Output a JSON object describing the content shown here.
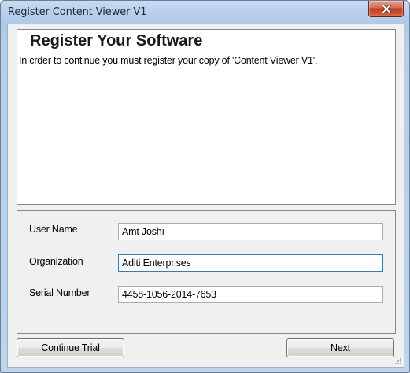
{
  "window": {
    "title": "Register Content Viewer V1"
  },
  "header": {
    "title": "Register Your Software",
    "description": "In crder to continue you must register your copy of 'Content Viewer V1'."
  },
  "form": {
    "fields": [
      {
        "label": "User Name",
        "value": "Amt Joshı"
      },
      {
        "label": "Organization",
        "value": "Aditi Enterprises"
      },
      {
        "label": "Serial Number",
        "value": "4458-1056-2014-7653"
      }
    ]
  },
  "buttons": {
    "continue_trial": "Continue Trial",
    "next": "Next"
  },
  "icons": {
    "close": "close-icon",
    "resize": "resize-grip-icon"
  },
  "colors": {
    "close_button": "#c2391c",
    "title_bar": "#b9d1ec",
    "dialog_background": "#f0f0f0",
    "focus_border": "#3d7bad"
  }
}
